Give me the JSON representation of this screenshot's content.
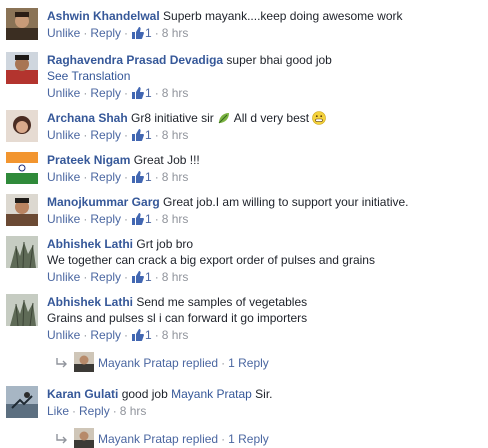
{
  "ui": {
    "like": "Like",
    "unlike": "Unlike",
    "reply": "Reply",
    "sep": "·",
    "see_translation": "See Translation"
  },
  "comments": [
    {
      "author": "Ashwin Khandelwal",
      "text": "Superb mayank....keep doing awesome work",
      "likes": "1",
      "time": "8 hrs",
      "action": "Unlike"
    },
    {
      "author": "Raghavendra Prasad Devadiga",
      "text": "super bhai good job",
      "likes": "1",
      "time": "8 hrs",
      "action": "Unlike"
    },
    {
      "author": "Archana Shah",
      "text_a": "Gr8 initiative sir",
      "text_b": "All d very best",
      "likes": "1",
      "time": "8 hrs",
      "action": "Unlike"
    },
    {
      "author": "Prateek Nigam",
      "text": "Great Job !!!",
      "likes": "1",
      "time": "8 hrs",
      "action": "Unlike"
    },
    {
      "author": "Manojkummar Garg",
      "text": "Great job.I am willing to support your initiative.",
      "likes": "1",
      "time": "8 hrs",
      "action": "Unlike"
    },
    {
      "author": "Abhishek Lathi",
      "text": "Grt job bro",
      "text2": "We together can crack a big export order of pulses and grains",
      "likes": "1",
      "time": "8 hrs",
      "action": "Unlike"
    },
    {
      "author": "Abhishek Lathi",
      "text": "Send me samples of vegetables",
      "text2": "Grains and pulses sl i can forward it go importers",
      "likes": "1",
      "time": "8 hrs",
      "action": "Unlike",
      "replies": {
        "name": "Mayank Pratap",
        "replied": "replied",
        "count": "1 Reply"
      }
    },
    {
      "author": "Karan Gulati",
      "text": "good job",
      "mention": "Mayank Pratap",
      "text_end": "Sir.",
      "time": "8 hrs",
      "action": "Like",
      "replies": {
        "name": "Mayank Pratap",
        "replied": "replied",
        "count": "1 Reply"
      }
    }
  ],
  "colors": {
    "link": "#365899",
    "meta": "#90949c",
    "like_blue": "#4267b2"
  },
  "icons": [
    "thumbs-up-icon",
    "leaf-emoji-icon",
    "grin-emoji-icon",
    "reply-arrow-icon"
  ]
}
